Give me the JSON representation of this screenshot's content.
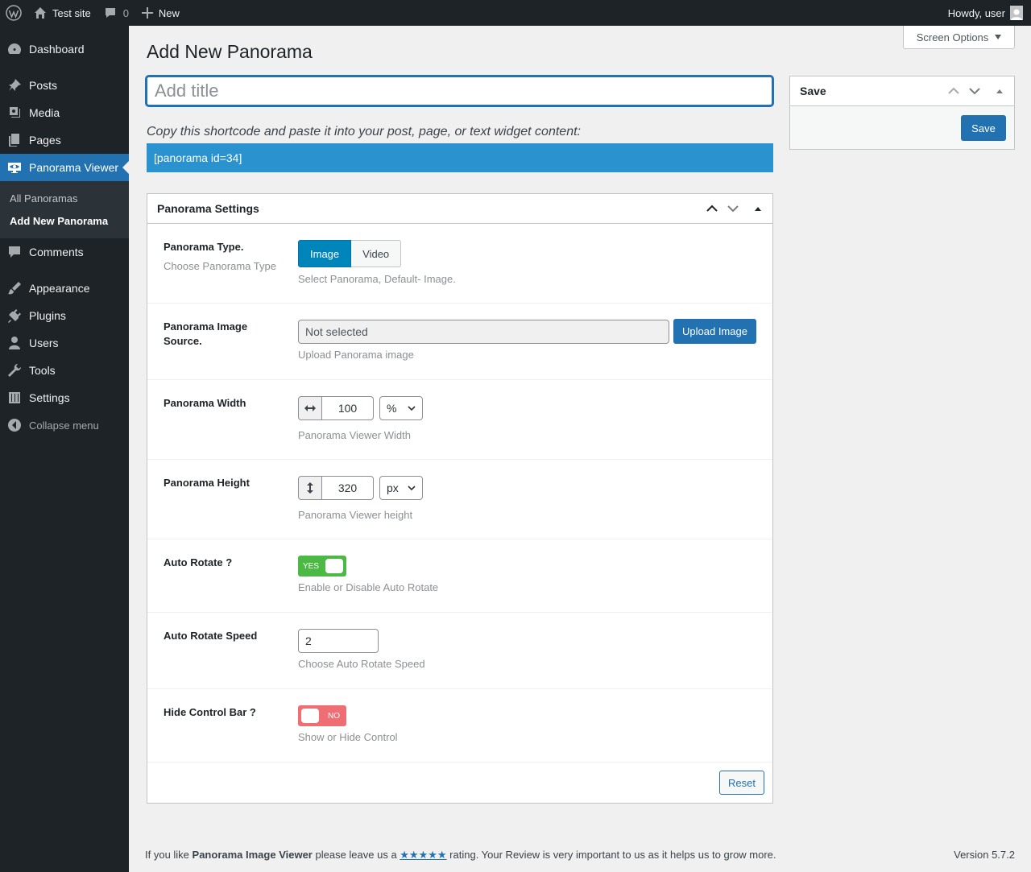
{
  "adminbar": {
    "site_name": "Test site",
    "comments_count": "0",
    "new_label": "New",
    "howdy": "Howdy, user"
  },
  "sidebar": {
    "items": [
      {
        "label": "Dashboard",
        "icon": "dashboard-icon"
      },
      {
        "label": "Posts",
        "icon": "pushpin-icon"
      },
      {
        "label": "Media",
        "icon": "media-icon"
      },
      {
        "label": "Pages",
        "icon": "pages-icon"
      },
      {
        "label": "Panorama Viewer",
        "icon": "eye-screen-icon"
      },
      {
        "label": "Comments",
        "icon": "comment-icon"
      },
      {
        "label": "Appearance",
        "icon": "paintbrush-icon"
      },
      {
        "label": "Plugins",
        "icon": "plug-icon"
      },
      {
        "label": "Users",
        "icon": "user-icon"
      },
      {
        "label": "Tools",
        "icon": "wrench-icon"
      },
      {
        "label": "Settings",
        "icon": "settings-sliders-icon"
      }
    ],
    "submenu": [
      "All Panoramas",
      "Add New Panorama"
    ],
    "collapse_label": "Collapse menu"
  },
  "screen_options": "Screen Options",
  "page_title": "Add New Panorama",
  "title_placeholder": "Add title",
  "shortcode": {
    "label": "Copy this shortcode and paste it into your post, page, or text widget content:",
    "value": "[panorama id=34]"
  },
  "settings": {
    "title": "Panorama Settings",
    "type": {
      "label": "Panorama Type.",
      "sublabel": "Choose Panorama Type",
      "options": [
        "Image",
        "Video"
      ],
      "selected": "Image",
      "help": "Select Panorama, Default- Image."
    },
    "source": {
      "label": "Panorama Image Source.",
      "value": "Not selected",
      "button": "Upload Image",
      "help": "Upload Panorama image"
    },
    "width": {
      "label": "Panorama Width",
      "value": "100",
      "unit": "%",
      "help": "Panorama Viewer Width"
    },
    "height": {
      "label": "Panorama Height",
      "value": "320",
      "unit": "px",
      "help": "Panorama Viewer height"
    },
    "auto_rotate": {
      "label": "Auto Rotate ?",
      "state": "YES",
      "help": "Enable or Disable Auto Rotate"
    },
    "rotate_speed": {
      "label": "Auto Rotate Speed",
      "value": "2",
      "help": "Choose Auto Rotate Speed"
    },
    "hide_control": {
      "label": "Hide Control Bar ?",
      "state": "NO",
      "help": "Show or Hide Control"
    },
    "reset_label": "Reset"
  },
  "save_box": {
    "title": "Save",
    "button": "Save"
  },
  "footer": {
    "text_before": "If you like ",
    "plugin_name": "Panorama Image Viewer",
    "text_mid": " please leave us a ",
    "stars": "★★★★★",
    "text_after": " rating. Your Review is very important to us as it helps us to grow more.",
    "version": "Version 5.7.2"
  },
  "colors": {
    "admin_dark": "#1d2327",
    "accent": "#2271b1",
    "shortcode_bg": "#2a92ce",
    "toggle_on": "#4cb944",
    "toggle_off": "#ee6e73"
  }
}
